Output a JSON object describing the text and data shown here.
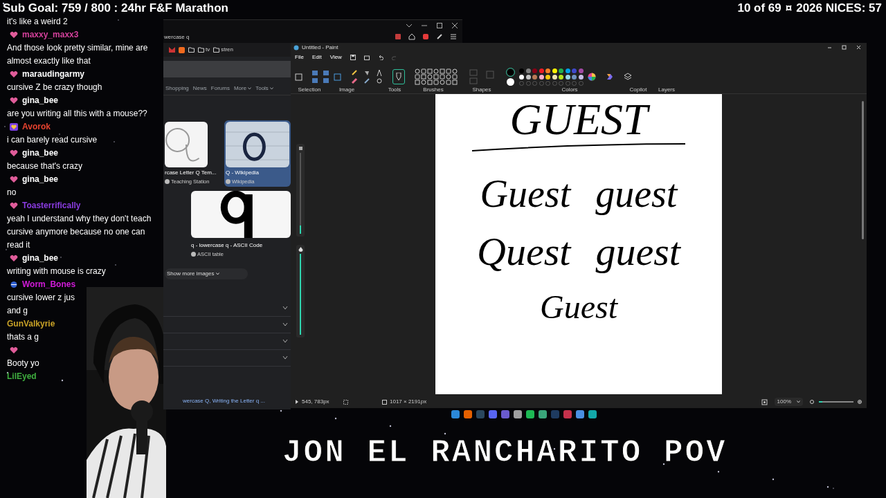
{
  "overlay": {
    "sub_goal": "Sub Goal: 759 / 800 : 24hr F&F Marathon",
    "counter": "10 of 69",
    "separator": "¤",
    "nices": "2026 NICES: 57",
    "banner": "JON EL RANCHARITO POV"
  },
  "chat": [
    {
      "text": "it's like a weird 2"
    },
    {
      "user": "maxxy_maxx3",
      "color": "#d4409b",
      "kind": "heart",
      "text": "And those look pretty similar, mine are almost exactly like that"
    },
    {
      "user": "maraudingarmy",
      "color": "#ffffff",
      "kind": "heart",
      "text": "cursive Z be crazy though"
    },
    {
      "user": "gina_bee",
      "color": "#ffffff",
      "kind": "heart",
      "text": "are you writing all this with a mouse??"
    },
    {
      "user": "Avorok",
      "color": "#e8432f",
      "kind": "gold",
      "text": "i can barely read cursive"
    },
    {
      "user": "gina_bee",
      "color": "#ffffff",
      "kind": "heart",
      "text": "because that's crazy"
    },
    {
      "user": "gina_bee",
      "color": "#ffffff",
      "kind": "heart",
      "text": "no"
    },
    {
      "user": "Toasterrifically",
      "color": "#8a3ce0",
      "kind": "heart",
      "text": "yeah I understand why they don't teach cursive anymore because no one can read it"
    },
    {
      "user": "gina_bee",
      "color": "#ffffff",
      "kind": "heart",
      "text": "writing with mouse is crazy"
    },
    {
      "user": "Worm_Bones",
      "color": "#d01ad8",
      "kind": "globe",
      "text": "cursive lower z jus"
    },
    {
      "text": "and g"
    },
    {
      "user": "GunValkyrie",
      "color": "#c9a227",
      "text": "thats a g"
    },
    {
      "kind": "heart",
      "text": "Booty yo"
    },
    {
      "user": "LilEyed",
      "color": "#3fae3f"
    }
  ],
  "browser": {
    "address": "wercase q",
    "bookmarks": [
      "tv",
      "stren"
    ],
    "tabs": [
      {
        "label": "Shopping",
        "menu": false
      },
      {
        "label": "News",
        "menu": false
      },
      {
        "label": "Forums",
        "menu": false
      },
      {
        "label": "More",
        "menu": true
      },
      {
        "label": "Tools",
        "menu": true
      }
    ],
    "results": [
      {
        "title": "rcase Letter Q Tem...",
        "source": "Teaching Station",
        "selected": false
      },
      {
        "title": "Q - Wikipedia",
        "source": "Wikipedia",
        "selected": true
      }
    ],
    "results_row2": [
      {
        "title": "q - lowercase q - ASCII Code",
        "source": "ASCII table"
      }
    ],
    "show_more": "Show more images",
    "sections": [
      {
        "expanded": false
      },
      {
        "expanded": false
      },
      {
        "expanded": false
      },
      {
        "expanded": false
      }
    ],
    "link": "wercase Q, Writing the Letter q ..."
  },
  "paint": {
    "title": "Untitled - Paint",
    "menu": [
      "File",
      "Edit",
      "View"
    ],
    "groups": [
      "Selection",
      "Image",
      "Tools",
      "Brushes",
      "Shapes",
      "Colors",
      "Copilot",
      "Layers"
    ],
    "palette_rows": [
      {
        "swatches": [
          {
            "color": "#000000"
          },
          {
            "color": "#7f7f7f"
          },
          {
            "color": "#880015"
          },
          {
            "color": "#ed1c24"
          },
          {
            "color": "#ff7f27"
          },
          {
            "color": "#fff200"
          },
          {
            "color": "#22b14c"
          },
          {
            "color": "#00a2e8"
          },
          {
            "color": "#3f48cc"
          },
          {
            "color": "#a349a4"
          }
        ]
      },
      {
        "swatches": [
          {
            "color": "#ffffff"
          },
          {
            "color": "#c3c3c3"
          },
          {
            "color": "#b97a57"
          },
          {
            "color": "#ffaec9"
          },
          {
            "color": "#ffc90e"
          },
          {
            "color": "#efe4b0"
          },
          {
            "color": "#b5e61d"
          },
          {
            "color": "#99d9ea"
          },
          {
            "color": "#7092be"
          },
          {
            "color": "#c8bfe7"
          }
        ]
      }
    ],
    "current_colors": [
      {
        "color": "#000000"
      },
      {
        "color": "#ffffff"
      }
    ],
    "size_slider": {
      "level": 0.1
    },
    "opacity_slider": {
      "level": 1
    },
    "canvas_lines": [
      {
        "words": [
          "GUEST"
        ],
        "underlined": true
      },
      {
        "words": [
          "Guest",
          "guest"
        ],
        "underlined": false
      },
      {
        "words": [
          "Quest",
          "guest"
        ],
        "underlined": false
      },
      {
        "words": [
          "Guest"
        ],
        "underlined": false
      }
    ],
    "cursor": "545, 783px",
    "canvas_size": "1017 × 2191px",
    "zoom": "100%",
    "zoom_slider": {
      "level": 0.1
    }
  },
  "taskbar": [
    {
      "color": "#2b88d8"
    },
    {
      "color": "#e66000"
    },
    {
      "color": "#2a475e"
    },
    {
      "color": "#5865f2"
    },
    {
      "color": "#6a5acd"
    },
    {
      "color": "#9e9e9e"
    },
    {
      "color": "#1db954"
    },
    {
      "color": "#3aa57a"
    },
    {
      "color": "#1e3a5f"
    },
    {
      "color": "#c4314b"
    },
    {
      "color": "#4a90e2"
    },
    {
      "color": "#13a8a8"
    }
  ]
}
